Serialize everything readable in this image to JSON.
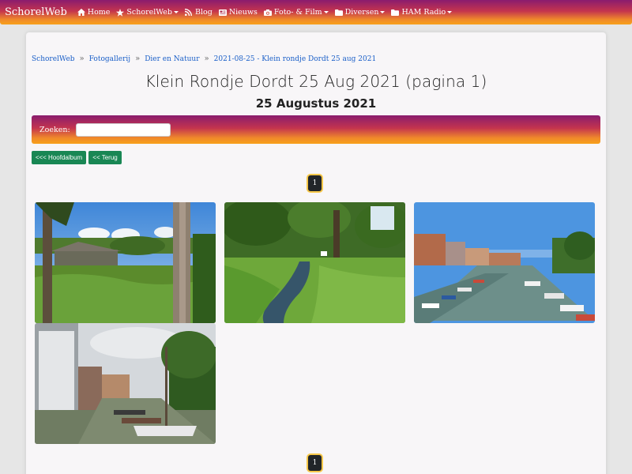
{
  "navbar": {
    "brand": "SchorelWeb",
    "items": [
      {
        "label": "Home",
        "icon": "home-icon",
        "dropdown": false
      },
      {
        "label": "SchorelWeb",
        "icon": "star-icon",
        "dropdown": true
      },
      {
        "label": "Blog",
        "icon": "rss-icon",
        "dropdown": false
      },
      {
        "label": "Nieuws",
        "icon": "newspaper-icon",
        "dropdown": false
      },
      {
        "label": "Foto- & Film",
        "icon": "camera-icon",
        "dropdown": true
      },
      {
        "label": "Diversen",
        "icon": "folder-icon",
        "dropdown": true
      },
      {
        "label": "HAM Radio",
        "icon": "folder-icon",
        "dropdown": true
      }
    ]
  },
  "breadcrumb": {
    "items": [
      "SchorelWeb",
      "Fotogallerij",
      "Dier en Natuur",
      "2021-08-25 - Klein rondje Dordt 25 aug 2021"
    ],
    "separator": "»"
  },
  "page": {
    "title": "Klein Rondje Dordt 25 Aug 2021 (pagina 1)",
    "subtitle": "25 Augustus 2021"
  },
  "search": {
    "label": "Zoeken:",
    "value": ""
  },
  "buttons": {
    "main_album": "<<< Hoofdalbum",
    "back": "<< Terug"
  },
  "pagination": {
    "current": "1"
  },
  "photos": [
    {
      "name": "photo-farm-trees",
      "subject": "trees and farm building"
    },
    {
      "name": "photo-canal-meadow",
      "subject": "green canal with trees"
    },
    {
      "name": "photo-harbor-boats",
      "subject": "harbor with boats"
    },
    {
      "name": "photo-city-canal",
      "subject": "city canal with boats"
    }
  ],
  "colors": {
    "gradient_top": "#8a1c6e",
    "gradient_bottom": "#f7a11a",
    "button_green": "#198754",
    "link_blue": "#1a5fc8"
  }
}
